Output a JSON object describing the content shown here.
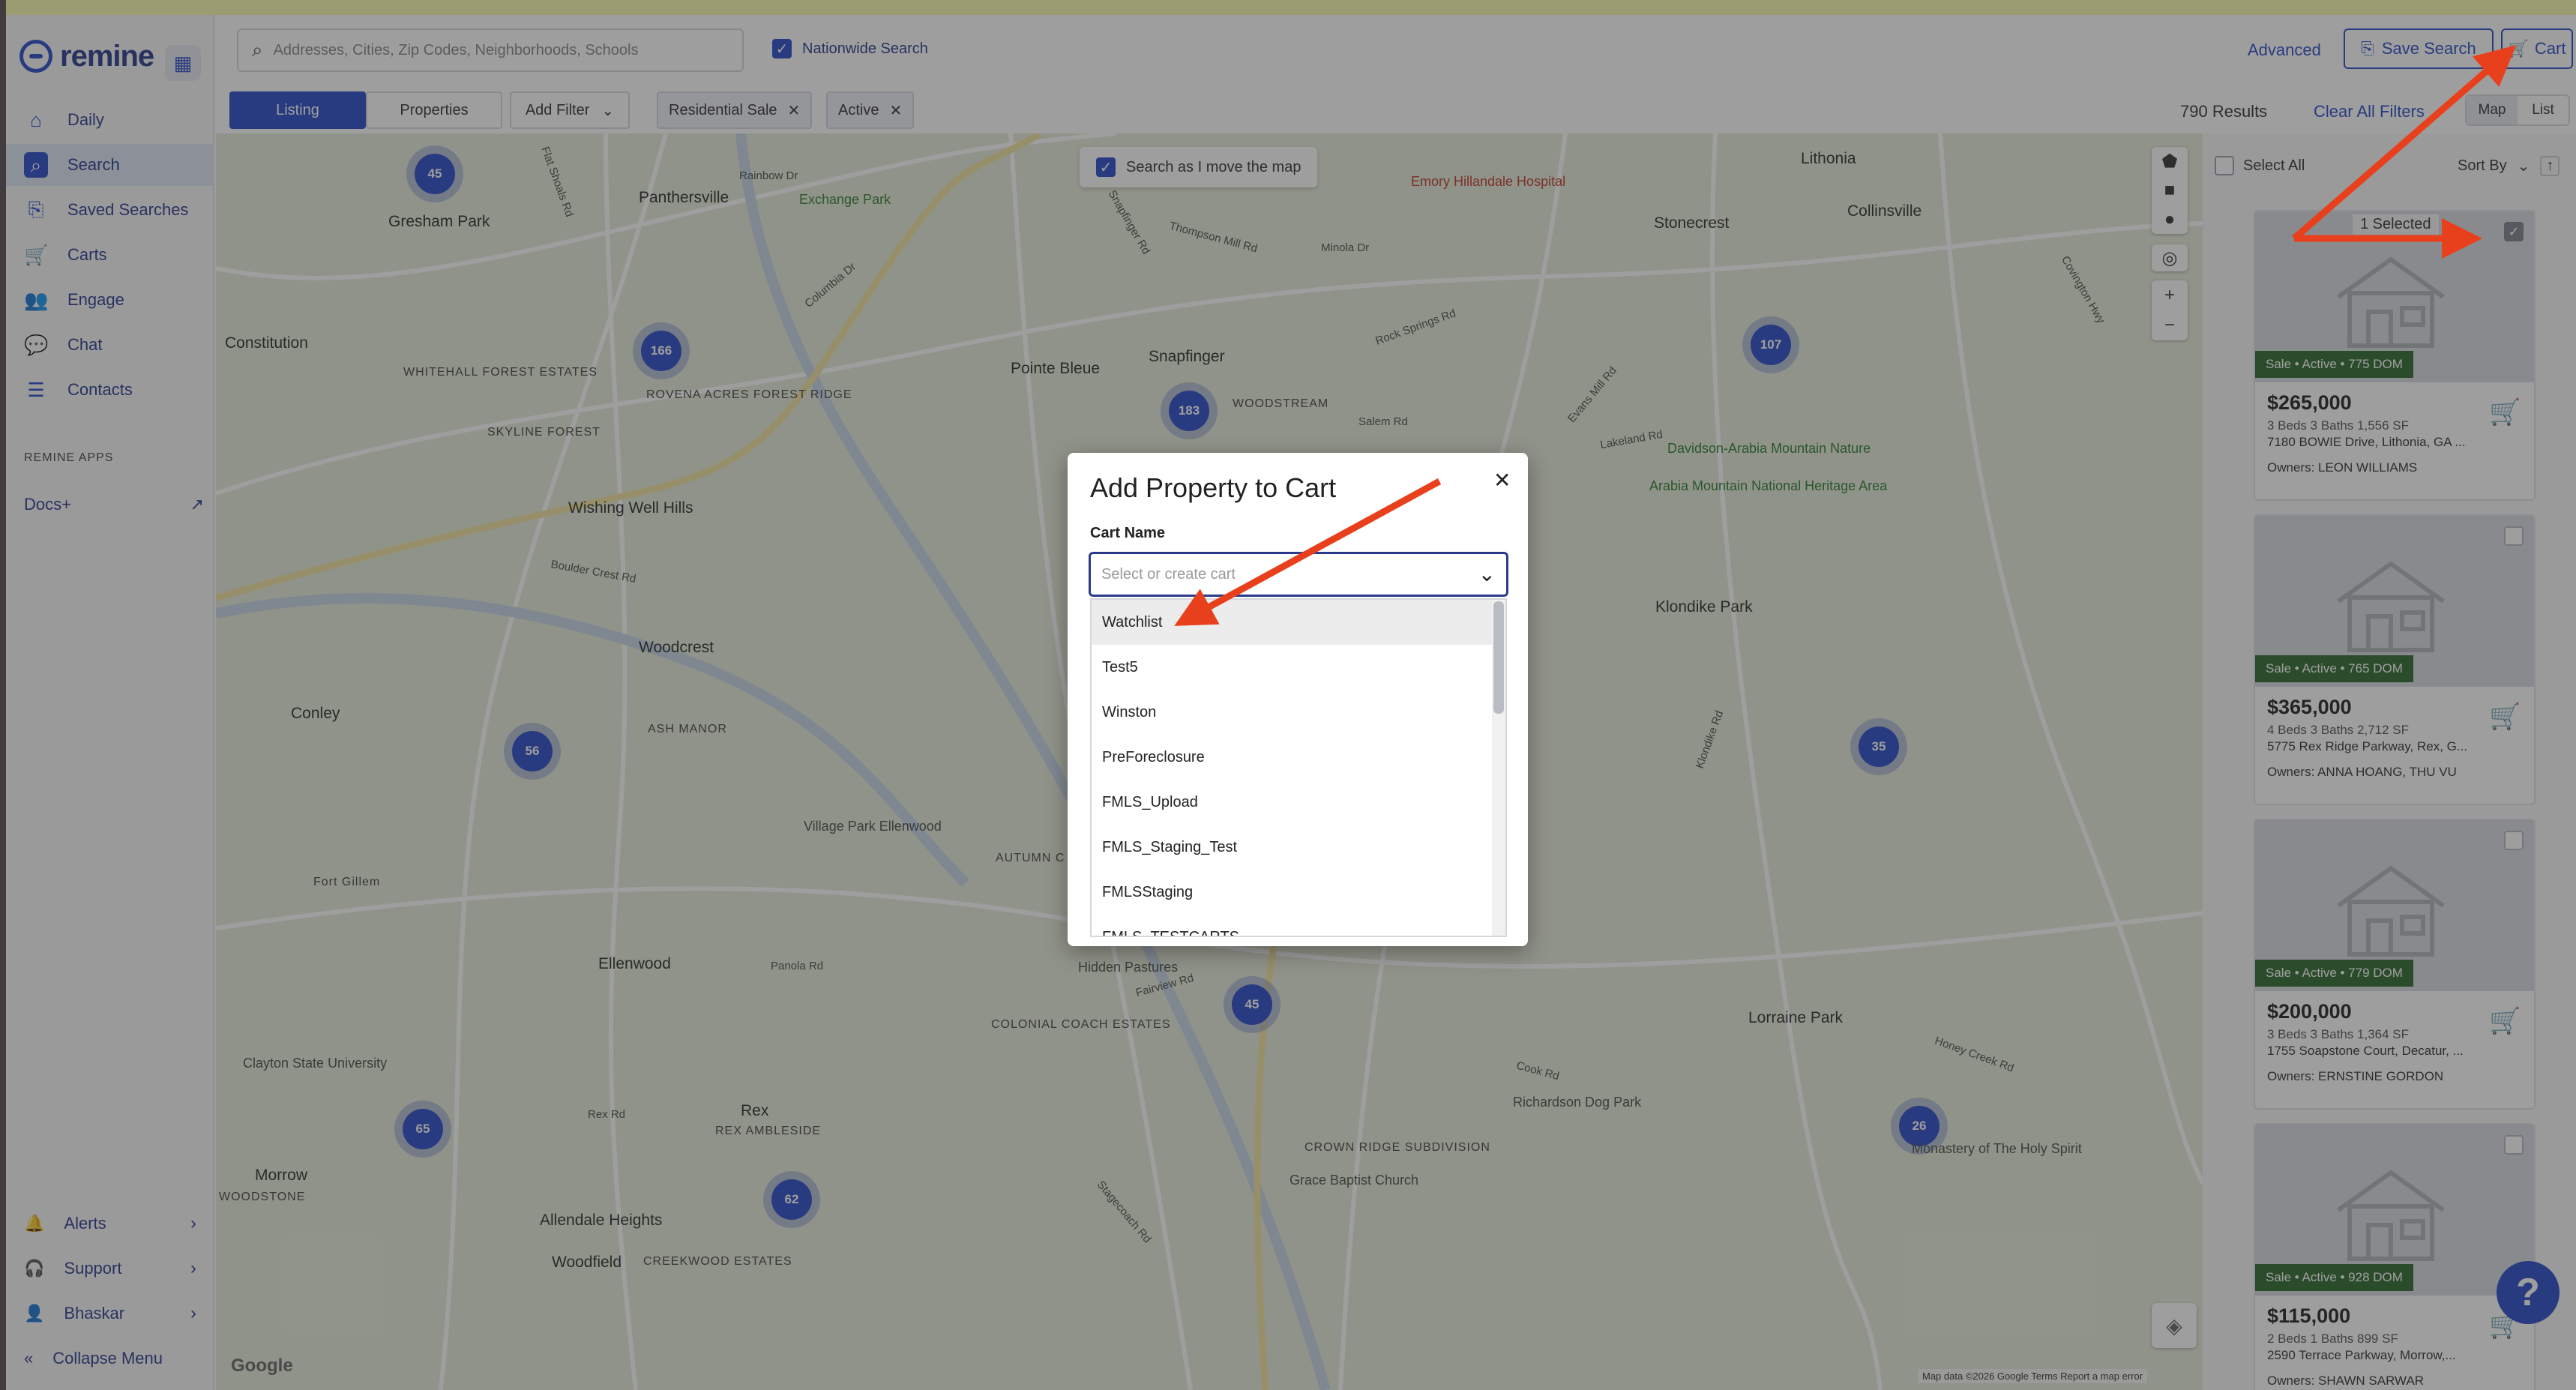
{
  "app": {
    "brand": "remine"
  },
  "sidebar": {
    "items": [
      {
        "label": "Daily",
        "icon": "daily-icon"
      },
      {
        "label": "Search",
        "icon": "search-icon"
      },
      {
        "label": "Saved Searches",
        "icon": "bookmark-icon"
      },
      {
        "label": "Carts",
        "icon": "cart-icon"
      },
      {
        "label": "Engage",
        "icon": "people-icon"
      },
      {
        "label": "Chat",
        "icon": "chat-icon"
      },
      {
        "label": "Contacts",
        "icon": "contacts-icon"
      }
    ],
    "apps_heading": "REMINE APPS",
    "docs_label": "Docs+",
    "bottom": [
      {
        "label": "Alerts",
        "icon": "bell-icon"
      },
      {
        "label": "Support",
        "icon": "headset-icon"
      },
      {
        "label": "Bhaskar",
        "icon": "user-icon"
      }
    ],
    "collapse_label": "Collapse Menu"
  },
  "header": {
    "search_placeholder": "Addresses, Cities, Zip Codes, Neighborhoods, Schools",
    "nationwide_label": "Nationwide Search",
    "advanced_label": "Advanced",
    "save_search_label": "Save Search",
    "cart_label": "Cart"
  },
  "filters": {
    "tabs": [
      "Listing",
      "Properties"
    ],
    "add_filter_label": "Add Filter",
    "chips": [
      "Residential Sale",
      "Active"
    ],
    "results_text": "790 Results",
    "clear_all_label": "Clear All Filters",
    "view_modes": [
      "Map",
      "List"
    ]
  },
  "map": {
    "search_as_move_label": "Search as I move the map",
    "clusters": [
      "45",
      "166",
      "183",
      "107",
      "56",
      "35",
      "45",
      "65",
      "62",
      "26"
    ],
    "places": [
      "Panthersville",
      "Gresham Park",
      "Constitution",
      "Wishing Well Hills",
      "Pointe Bleue",
      "Snapfinger",
      "Woodcrest",
      "Conley",
      "Fort Gillem",
      "Ellenwood",
      "Rex",
      "Morrow",
      "Allendale Heights",
      "Woodfield",
      "Lithonia",
      "Collinsville",
      "Stonecrest",
      "Klondike Park",
      "Lorraine Park",
      "Richardson Dog Park",
      "Monastery of The Holy Spirit",
      "Hidden Pastures",
      "Village Park Ellenwood",
      "Clayton State University"
    ],
    "areas": [
      "WHITEHALL FOREST ESTATES",
      "ROVENA ACRES FOREST RIDGE",
      "SKYLINE FOREST",
      "ASH MANOR",
      "WOODSTREAM",
      "AUTUMN C",
      "COLONIAL COACH ESTATES",
      "CROWN RIDGE SUBDIVISION",
      "REX AMBLESIDE",
      "CREEKWOOD ESTATES",
      "WOODSTONE"
    ],
    "pois": [
      "Emory Hillandale Hospital",
      "Davidson-Arabia Mountain Nature",
      "Arabia Mountain National Heritage Area",
      "Grace Baptist Church",
      "Exchange Park"
    ],
    "roads": [
      "Rainbow Dr",
      "Flat Shoals Rd",
      "Snapfinger Rd",
      "Thompson Mill Rd",
      "Minola Dr",
      "Rock Springs Rd",
      "Evans Mill Rd",
      "Salem Rd",
      "Lakeland Rd",
      "Panola Rd",
      "Fairview Rd",
      "Rex Rd",
      "Cook Rd",
      "Klondike Rd",
      "Honey Creek Rd",
      "Stagecoach Rd",
      "Columbia Dr",
      "Boulder Crest Rd",
      "Covington Hwy"
    ],
    "footer": "Map data ©2026 Google   Terms   Report a map error",
    "google_label": "Google"
  },
  "panel": {
    "select_all_label": "Select All",
    "sort_by_label": "Sort By",
    "selected_label": "1 Selected",
    "listings": [
      {
        "badge": "Sale • Active • 775 DOM",
        "price": "$265,000",
        "beds": "3 Beds 3 Baths 1,556 SF",
        "address": "7180 BOWIE Drive, Lithonia, GA ...",
        "owners": "Owners: LEON WILLIAMS",
        "selected": true
      },
      {
        "badge": "Sale • Active • 765 DOM",
        "price": "$365,000",
        "beds": "4 Beds 3 Baths 2,712 SF",
        "address": "5775 Rex Ridge Parkway, Rex, G...",
        "owners": "Owners: ANNA HOANG, THU VU",
        "selected": false
      },
      {
        "badge": "Sale • Active • 779 DOM",
        "price": "$200,000",
        "beds": "3 Beds 3 Baths 1,364 SF",
        "address": "1755 Soapstone Court, Decatur, ...",
        "owners": "Owners: ERNSTINE GORDON",
        "selected": false
      },
      {
        "badge": "Sale • Active • 928 DOM",
        "price": "$115,000",
        "beds": "2 Beds 1 Baths 899 SF",
        "address": "2590 Terrace Parkway, Morrow,...",
        "owners": "Owners: SHAWN SARWAR",
        "selected": false
      }
    ]
  },
  "modal": {
    "title": "Add Property to Cart",
    "field_label": "Cart Name",
    "placeholder": "Select or create cart",
    "options": [
      "Watchlist",
      "Test5",
      "Winston",
      "PreForeclosure",
      "FMLS_Upload",
      "FMLS_Staging_Test",
      "FMLSStaging",
      "FMLS_TESTCARTS"
    ]
  },
  "help_label": "?",
  "colors": {
    "brand": "#2b4cc8",
    "badge": "#2f6b2f",
    "annotation_arrow": "#e8401c"
  }
}
